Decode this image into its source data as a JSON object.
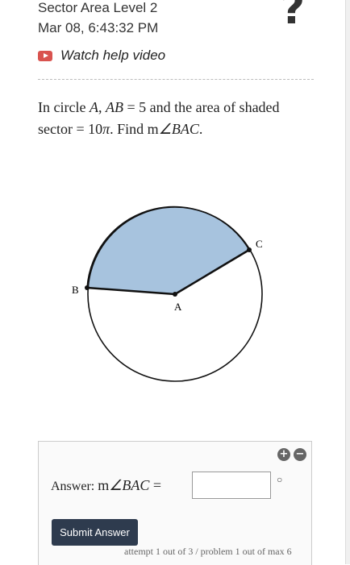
{
  "header": {
    "title": "Sector Area Level 2",
    "datetime": "Mar 08, 6:43:32 PM",
    "help_symbol": "?",
    "help_video_label": "Watch help video"
  },
  "problem": {
    "line1_pre": "In circle ",
    "circle": "A",
    "line1_mid": ", ",
    "segment": "AB",
    "equals": " = ",
    "ab_value": "5",
    "line1_post": " and the area of shaded",
    "line2_pre": "sector = ",
    "area_value": "10",
    "pi": "π",
    "line2_mid": ". Find m",
    "angle": "∠BAC",
    "line2_post": "."
  },
  "figure": {
    "label_b": "B",
    "label_a": "A",
    "label_c": "C",
    "shade_color": "#a7c3de",
    "stroke_color": "#111111"
  },
  "answer": {
    "plus": "+",
    "minus": "−",
    "label_pre": "Answer: ",
    "label_m": "m",
    "label_angle": "∠BAC",
    "label_eq": " = ",
    "degree_symbol": "○",
    "value": "",
    "submit_label": "Submit Answer",
    "attempt_text": "attempt 1 out of 3 / problem 1 out of max 6"
  }
}
